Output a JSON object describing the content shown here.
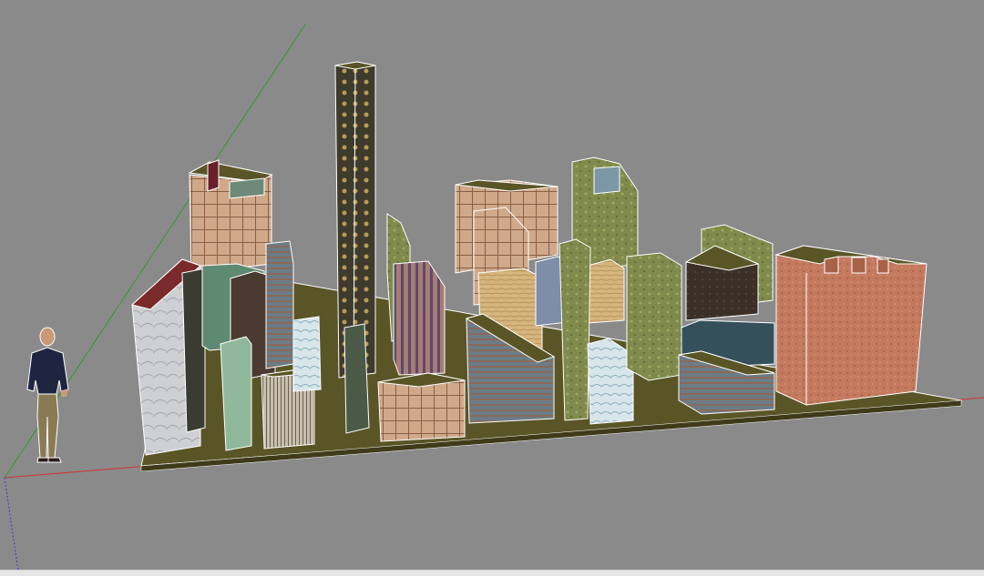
{
  "viewport": {
    "background": "#8a8a8a",
    "axes": {
      "red": "#d43030",
      "green": "#2e9a2e",
      "blue": "#3a3ac8"
    },
    "ground_color": "#5a5526",
    "edge_color": "#ffffff"
  },
  "scene_objects": [
    "city-block-model",
    "scale-figure-person",
    "tall-tower",
    "brick-building"
  ]
}
